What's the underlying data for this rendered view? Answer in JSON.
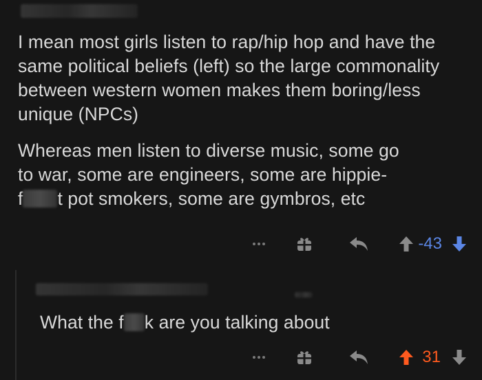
{
  "comment_1": {
    "paragraphs": [
      "I mean most girls listen to rap/hip hop and have the same political beliefs (left) so the large commonality between western women makes them boring/less unique (NPCs)"
    ],
    "para2_lines": [
      "Whereas men listen to diverse music, some go",
      "to war, some are engineers, some are hippie-",
      "pot smokers, some are gymbros, etc"
    ],
    "para2_censor_prefix": "f",
    "para2_censor_suffix": "t",
    "score": "-43",
    "score_color": "#5b86e5",
    "vote_state": "downvoted"
  },
  "comment_2": {
    "text_before_censor": "What the f",
    "text_after_censor": "k are you talking about",
    "score": "31",
    "score_color": "#ff5a1f",
    "vote_state": "upvoted"
  },
  "icons": {
    "more": "more-options-icon",
    "award": "award-gift-icon",
    "reply": "reply-arrow-icon",
    "upvote": "upvote-arrow-icon",
    "downvote": "downvote-arrow-icon"
  },
  "colors": {
    "background": "#161616",
    "text": "#d9d9d9",
    "icon_gray": "#8a8a8a",
    "upvote_orange": "#ff5a1f",
    "downvote_blue": "#5b86e5"
  }
}
